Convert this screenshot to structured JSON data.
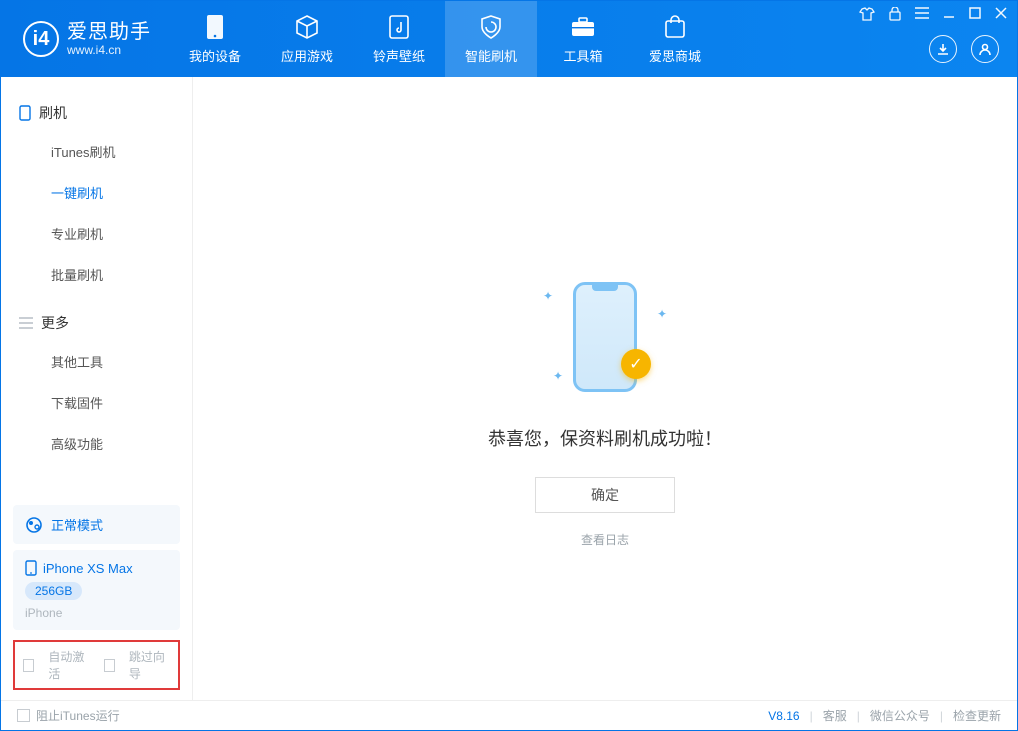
{
  "app": {
    "name_cn": "爱思助手",
    "url": "www.i4.cn"
  },
  "tabs": {
    "device": "我的设备",
    "apps": "应用游戏",
    "ring": "铃声壁纸",
    "flash": "智能刷机",
    "toolbox": "工具箱",
    "store": "爱思商城"
  },
  "sidebar": {
    "sec_flash": "刷机",
    "items_flash": {
      "itunes": "iTunes刷机",
      "one_click": "一键刷机",
      "pro": "专业刷机",
      "batch": "批量刷机"
    },
    "sec_more": "更多",
    "items_more": {
      "other": "其他工具",
      "download": "下载固件",
      "advanced": "高级功能"
    }
  },
  "mode": {
    "label": "正常模式"
  },
  "device": {
    "name": "iPhone XS Max",
    "storage": "256GB",
    "type": "iPhone"
  },
  "options": {
    "auto_activate": "自动激活",
    "skip_guide": "跳过向导"
  },
  "main": {
    "success_msg": "恭喜您，保资料刷机成功啦！",
    "ok": "确定",
    "log": "查看日志"
  },
  "footer": {
    "block_itunes": "阻止iTunes运行",
    "version": "V8.16",
    "support": "客服",
    "wechat": "微信公众号",
    "update": "检查更新"
  }
}
